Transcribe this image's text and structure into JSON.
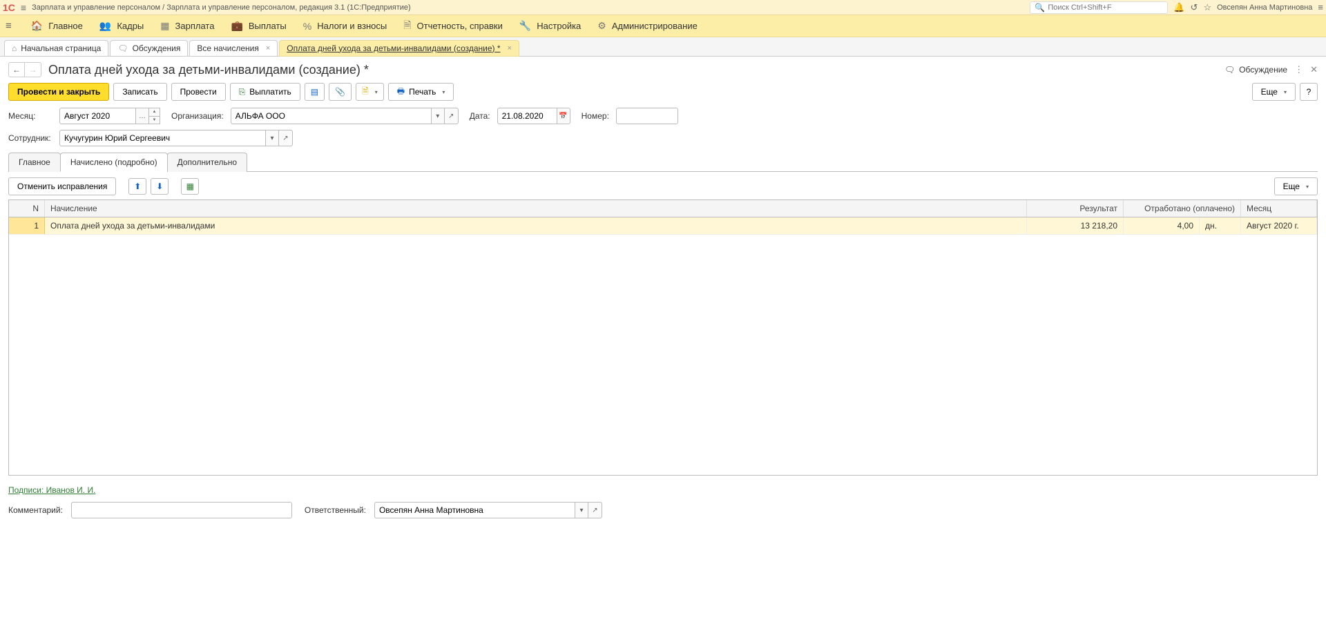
{
  "title_bar": {
    "app_title": "Зарплата и управление персоналом / Зарплата и управление персоналом, редакция 3.1  (1С:Предприятие)",
    "search_placeholder": "Поиск Ctrl+Shift+F",
    "user": "Овсепян Анна Мартиновна"
  },
  "main_menu": {
    "items": [
      "Главное",
      "Кадры",
      "Зарплата",
      "Выплаты",
      "Налоги и взносы",
      "Отчетность, справки",
      "Настройка",
      "Администрирование"
    ]
  },
  "tabs": {
    "home": "Начальная страница",
    "discussions": "Обсуждения",
    "all_accruals": "Все начисления",
    "current": "Оплата дней ухода за детьми-инвалидами (создание) *"
  },
  "page": {
    "title": "Оплата дней ухода за детьми-инвалидами (создание) *",
    "discussion_label": "Обсуждение"
  },
  "toolbar": {
    "post_close": "Провести и закрыть",
    "save": "Записать",
    "post": "Провести",
    "pay": "Выплатить",
    "print": "Печать",
    "more": "Еще",
    "help": "?"
  },
  "form": {
    "month_label": "Месяц:",
    "month_value": "Август 2020",
    "org_label": "Организация:",
    "org_value": "АЛЬФА ООО",
    "date_label": "Дата:",
    "date_value": "21.08.2020",
    "number_label": "Номер:",
    "number_value": "",
    "employee_label": "Сотрудник:",
    "employee_value": "Кучугурин Юрий Сергеевич"
  },
  "form_tabs": {
    "main": "Главное",
    "accrued": "Начислено (подробно)",
    "extra": "Дополнительно"
  },
  "sub_toolbar": {
    "cancel_fix": "Отменить исправления",
    "more": "Еще"
  },
  "table": {
    "headers": {
      "n": "N",
      "name": "Начисление",
      "result": "Результат",
      "worked": "Отработано (оплачено)",
      "month": "Месяц"
    },
    "rows": [
      {
        "n": "1",
        "name": "Оплата дней ухода за детьми-инвалидами",
        "result": "13 218,20",
        "worked": "4,00",
        "unit": "дн.",
        "month": "Август 2020 г."
      }
    ]
  },
  "footer": {
    "signatures": "Подписи: Иванов И. И.",
    "comment_label": "Комментарий:",
    "comment_value": "",
    "responsible_label": "Ответственный:",
    "responsible_value": "Овсепян Анна Мартиновна"
  }
}
